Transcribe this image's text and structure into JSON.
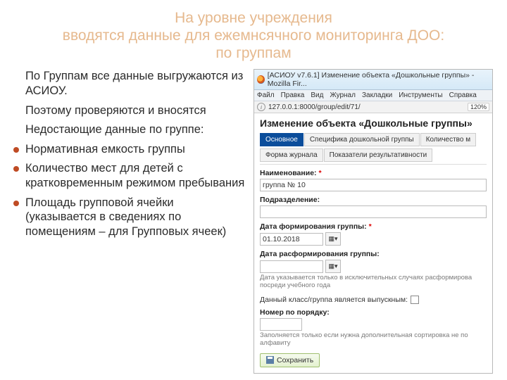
{
  "title": {
    "line1": "На уровне учреждения",
    "line2": "вводятся данные для ежемнсячного мониторинга ДОО:",
    "line3": "по группам"
  },
  "left_text": {
    "p1": "По Группам все данные выгружаются из АСИОУ.",
    "p2": "Поэтому проверяются и вносятся",
    "p3": "Недостающие данные по группе:",
    "b1": "Нормативная емкость группы",
    "b2": "Количество мест для детей с кратковременным режимом пребывания",
    "b3": "Площадь групповой ячейки (указывается в сведениях по помещениям – для Групповых ячеек)"
  },
  "app": {
    "win_title": "[АСИОУ v7.6.1] Изменение объекта «Дошкольные группы» - Mozilla Fir...",
    "menu": {
      "file": "Файл",
      "edit": "Правка",
      "view": "Вид",
      "history": "Журнал",
      "bookmarks": "Закладки",
      "tools": "Инструменты",
      "help": "Справка"
    },
    "url": "127.0.0.1:8000/group/edit/71/",
    "zoom": "120%",
    "page_header": "Изменение объекта «Дошкольные группы»",
    "tabs": {
      "main": "Основное",
      "spec": "Спецификa дошкольной группы",
      "count": "Количество м",
      "journal": "Форма журнала",
      "result": "Показатели результативности"
    },
    "form": {
      "name_label": "Наименование:",
      "name_value": "группа № 10",
      "dept_label": "Подразделение:",
      "dept_value": "",
      "form_date_label": "Дата формирования группы:",
      "form_date_value": "01.10.2018",
      "disband_label": "Дата расформирования группы:",
      "disband_value": "",
      "disband_hint": "Дата указывается только в исключительных случаях расформирова посреди учебного года",
      "graduating_label": "Данный класс/группа является выпускным:",
      "order_label": "Номер по порядку:",
      "order_hint": "Заполняется только если нужна дополнительная сортировка не по алфавиту",
      "save": "Сохранить"
    }
  }
}
